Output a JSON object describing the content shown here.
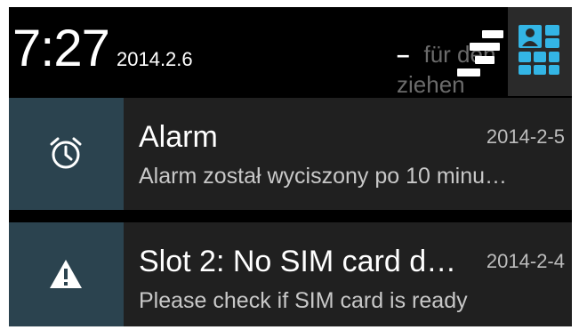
{
  "header": {
    "time": "7:27",
    "date": "2014.2.6",
    "hint_line1": "für den",
    "hint_line2": "ziehen",
    "hint_dash": "–",
    "clear_icon": "clear-all-icon",
    "settings_icon": "quick-settings-icon"
  },
  "notifications": [
    {
      "icon": "alarm-clock-icon",
      "title": "Alarm",
      "time": "2014-2-5",
      "text": "Alarm został wyciszony po 10 minu…"
    },
    {
      "icon": "warning-icon",
      "title": "Slot 2: No SIM card d…",
      "time": "2014-2-4",
      "text": "Please check if SIM card is ready"
    }
  ],
  "colors": {
    "shade_bg": "#000000",
    "notification_bg": "#202020",
    "icon_box_bg": "#2b434f",
    "accent": "#33b5e5"
  }
}
